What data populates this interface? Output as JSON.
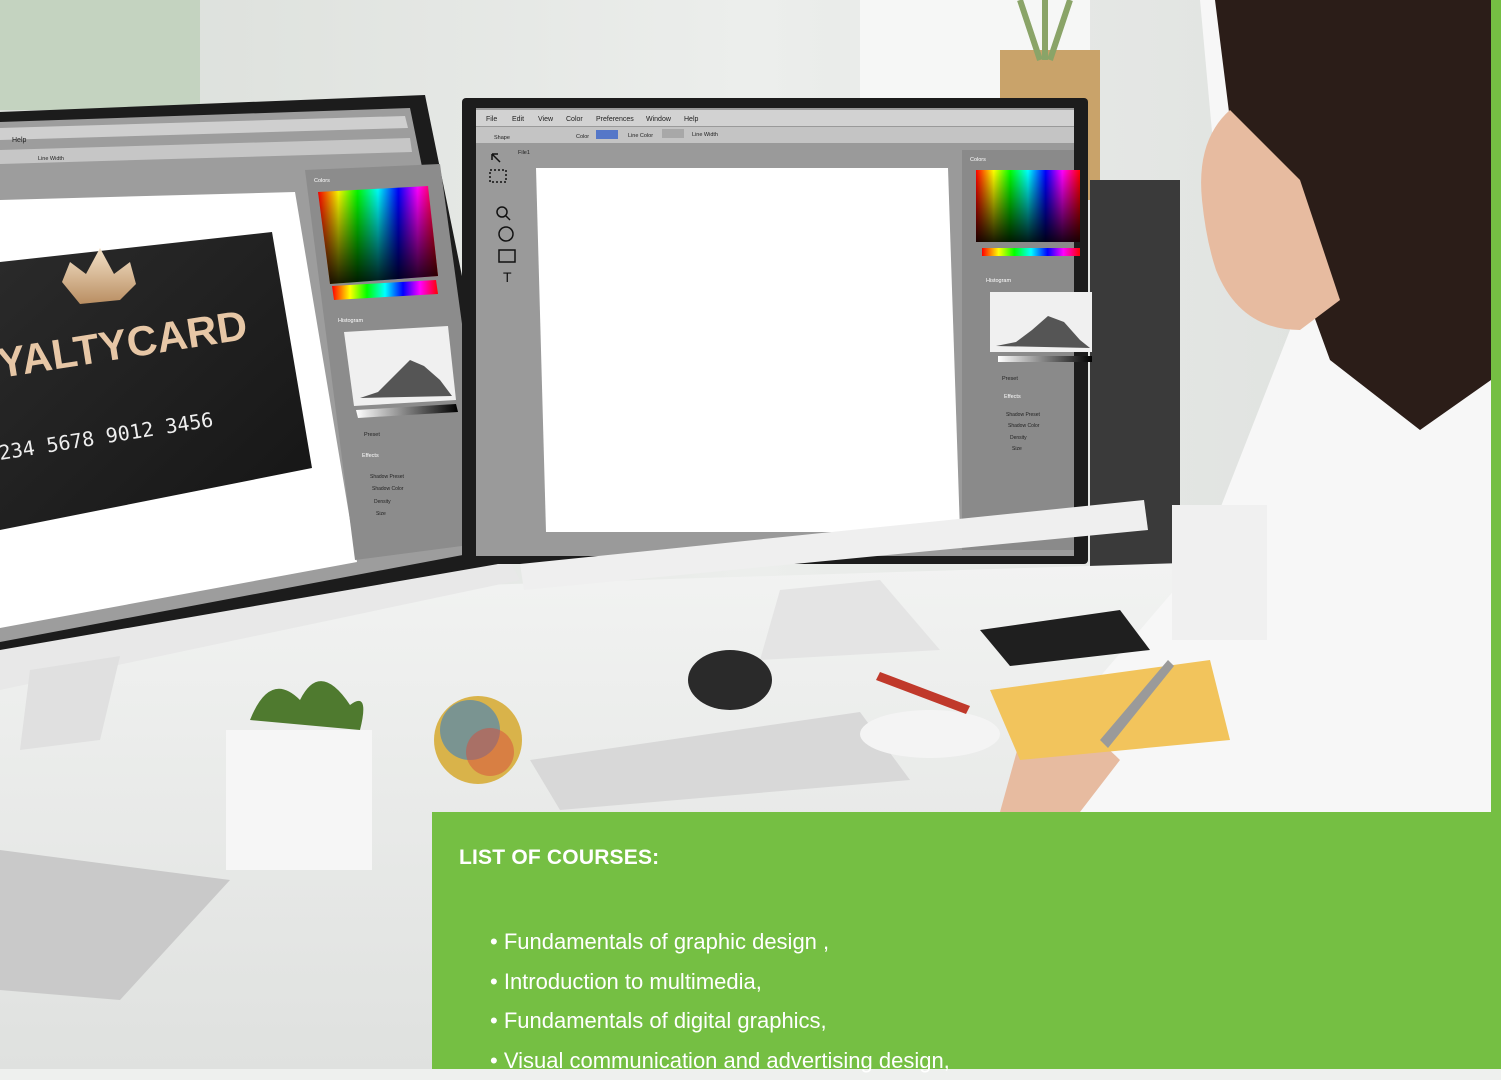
{
  "colors": {
    "panel_green": "#75bf43",
    "panel_text": "#ffffff",
    "right_border_green": "#75bf43"
  },
  "photo": {
    "card_screen": {
      "menu_help": "Help",
      "line_width_label": "Line Width",
      "card_title": "YALTYCARD",
      "card_number": "234 5678 9012 3456",
      "panel_colors": "Colors",
      "panel_histogram": "Histogram",
      "panel_effects": "Effects",
      "preset_label": "Preset",
      "shadow_preset": "Shadow Preset",
      "shadow_color": "Shadow Color",
      "density": "Density",
      "size": "Size"
    },
    "editor_screen": {
      "menu": [
        "File",
        "Edit",
        "View",
        "Color",
        "Preferences",
        "Window",
        "Help"
      ],
      "shape_label": "Shape",
      "color_label": "Color",
      "line_color_label": "Line Color",
      "line_width_label": "Line Width",
      "tab_label": "File1",
      "panel_colors": "Colors",
      "panel_histogram": "Histogram",
      "panel_effects": "Effects",
      "preset_label": "Preset",
      "shadow_preset": "Shadow Preset",
      "shadow_color": "Shadow Color",
      "density": "Density",
      "size": "Size"
    }
  },
  "courses": {
    "heading": "LIST OF COURSES:",
    "items": [
      "Fundamentals of graphic design ,",
      "Introduction to multimedia,",
      "Fundamentals of digital graphics,",
      "Visual communication and advertising design,"
    ]
  }
}
